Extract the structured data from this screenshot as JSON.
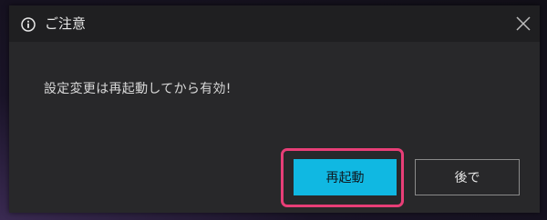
{
  "dialog": {
    "title": "ご注意",
    "title_icon": "info-icon",
    "close_icon": "close-icon",
    "message": "設定変更は再起動してから有効!",
    "buttons": {
      "restart_label": "再起動",
      "later_label": "後で"
    }
  },
  "colors": {
    "dialog_bg": "#28282a",
    "titlebar_bg": "#1f1f21",
    "primary_button": "#10b8e2",
    "highlight_border": "#e83e77"
  }
}
